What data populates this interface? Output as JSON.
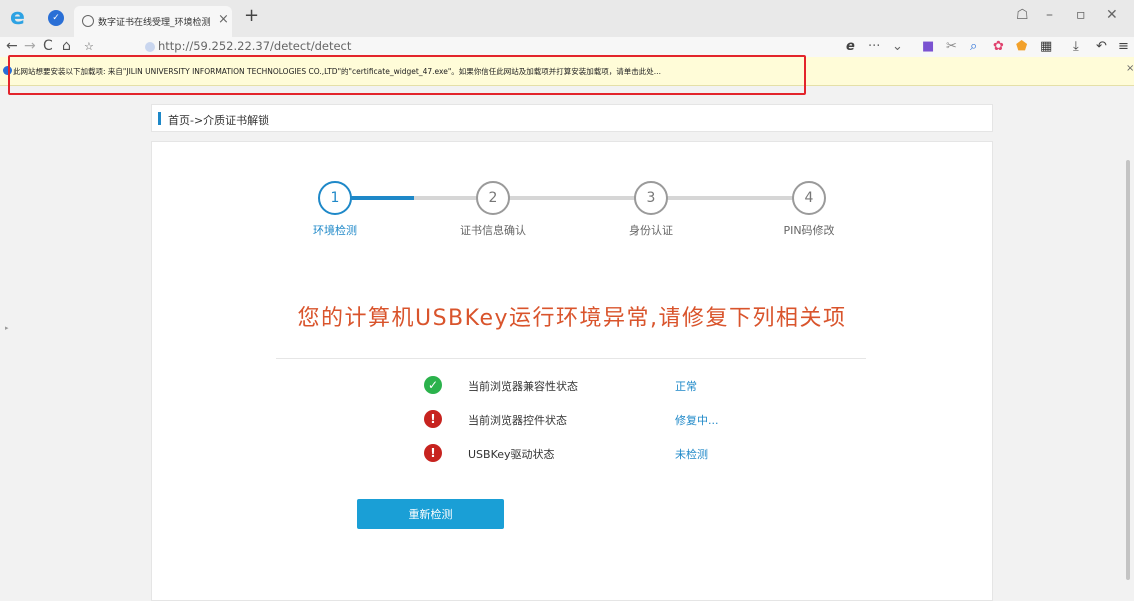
{
  "browser": {
    "tab_title": "数字证书在线受理_环境检测",
    "tab_close": "×",
    "new_tab": "+",
    "url": "http://59.252.22.37/detect/detect",
    "infobar_message": "此网站想要安装以下加载项: 来自\"JILIN UNIVERSITY INFORMATION TECHNOLOGIES CO.,LTD\"的\"certificate_widget_47.exe\"。如果你信任此网站及加载项并打算安装加载项，请单击此处...",
    "infobar_close": "×"
  },
  "breadcrumb": "首页->介质证书解锁",
  "steps": [
    {
      "number": "1",
      "label": "环境检测",
      "active": true
    },
    {
      "number": "2",
      "label": "证书信息确认",
      "active": false
    },
    {
      "number": "3",
      "label": "身份认证",
      "active": false
    },
    {
      "number": "4",
      "label": "PIN码修改",
      "active": false
    }
  ],
  "headline": "您的计算机USBKey运行环境异常,请修复下列相关项",
  "checks": [
    {
      "icon": "check-circle-icon",
      "label": "当前浏览器兼容性状态",
      "status": "正常"
    },
    {
      "icon": "exclamation-circle-icon",
      "label": "当前浏览器控件状态",
      "status": "修复中..."
    },
    {
      "icon": "exclamation-circle-icon",
      "label": "USBKey驱动状态",
      "status": "未检测"
    }
  ],
  "recheck_button": "重新检测",
  "colors": {
    "accent": "#1e88c8",
    "error": "#c7231f",
    "ok": "#2bb24c",
    "headline": "#d9542c",
    "button": "#1a9fd6"
  }
}
